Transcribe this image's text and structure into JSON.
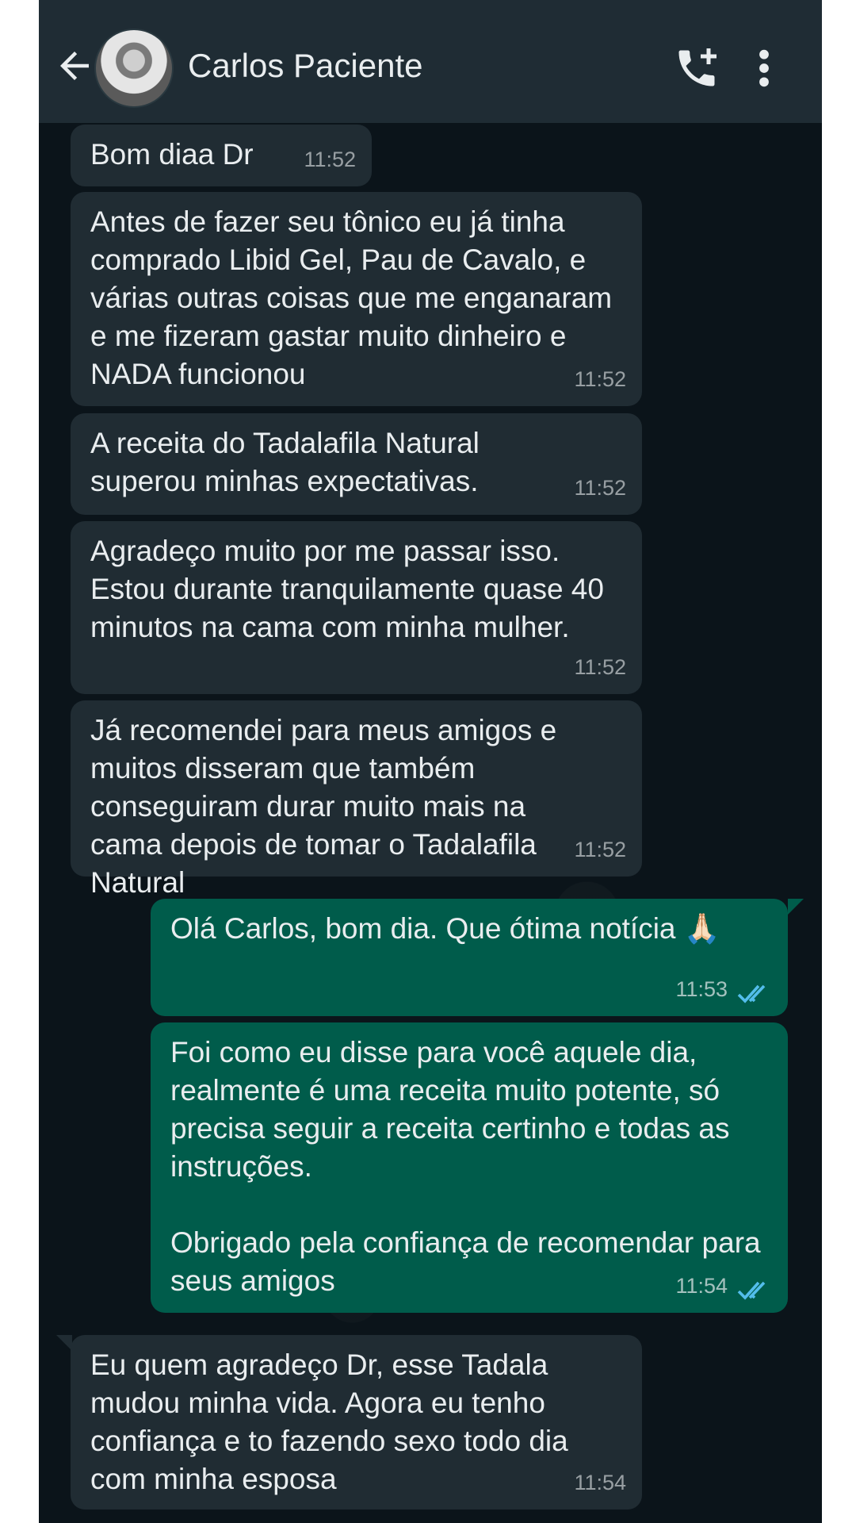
{
  "header": {
    "contact_name": "Carlos Paciente"
  },
  "icons": {
    "back": "arrow-left-icon",
    "call": "add-call-icon",
    "menu": "more-vert-icon"
  },
  "colors": {
    "header_bg": "#1f2c34",
    "chat_bg": "#0b141a",
    "incoming_bubble": "#202c33",
    "outgoing_bubble": "#005c4b",
    "read_ticks": "#53bdeb"
  },
  "messages": [
    {
      "direction": "in",
      "text": "Bom diaa Dr",
      "time": "11:52"
    },
    {
      "direction": "in",
      "text": "Antes de fazer seu tônico eu já tinha comprado Libid Gel, Pau de Cavalo, e várias outras coisas que me enganaram e me fizeram gastar muito dinheiro e NADA funcionou",
      "time": "11:52"
    },
    {
      "direction": "in",
      "text": "A receita do Tadalafila Natural superou minhas expectativas.",
      "time": "11:52"
    },
    {
      "direction": "in",
      "text": "Agradeço muito por me passar isso. Estou durante tranquilamente quase 40 minutos na cama com minha mulher.",
      "time": "11:52"
    },
    {
      "direction": "in",
      "text": "Já recomendei para meus amigos e muitos disseram que também conseguiram durar muito mais na cama depois de tomar o Tadalafila Natural",
      "time": "11:52"
    },
    {
      "direction": "out",
      "text": "Olá Carlos, bom dia. Que ótima notícia 🙏🏻",
      "time": "11:53",
      "status": "read"
    },
    {
      "direction": "out",
      "text": "Foi como eu disse para você aquele dia, realmente é uma receita muito potente, só precisa seguir a receita certinho e todas as instruções.\n\nObrigado pela confiança de recomendar para seus amigos",
      "time": "11:54",
      "status": "read"
    },
    {
      "direction": "in",
      "text": "Eu quem agradeço Dr, esse Tadala mudou minha vida. Agora eu tenho confiança e to fazendo sexo todo dia com minha esposa",
      "time": "11:54"
    }
  ]
}
